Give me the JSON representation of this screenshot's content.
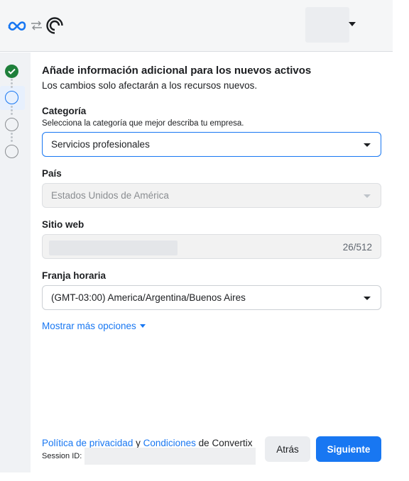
{
  "header": {
    "icons": [
      "meta-logo-icon",
      "swap-arrows-icon",
      "brand-logo-icon"
    ]
  },
  "stepper": {
    "steps": [
      {
        "state": "done",
        "icon": "check-icon"
      },
      {
        "state": "current"
      },
      {
        "state": "todo"
      },
      {
        "state": "todo"
      }
    ]
  },
  "form": {
    "title": "Añade información adicional para los nuevos activos",
    "subtitle": "Los cambios solo afectarán a los recursos nuevos.",
    "category": {
      "label": "Categoría",
      "help": "Selecciona la categoría que mejor describa tu empresa.",
      "value": "Servicios profesionales"
    },
    "country": {
      "label": "País",
      "value": "Estados Unidos de América"
    },
    "website": {
      "label": "Sitio web",
      "counter": "26/512"
    },
    "timezone": {
      "label": "Franja horaria",
      "value": "(GMT-03:00) America/Argentina/Buenos Aires"
    },
    "more_options": "Mostrar más opciones"
  },
  "footer": {
    "privacy_link": "Política de privacidad",
    "and": "y",
    "terms_link": "Condiciones",
    "of_company": "de Convertix",
    "session_label": "Session ID:",
    "back_label": "Atrás",
    "next_label": "Siguiente"
  },
  "colors": {
    "accent": "#1877f2",
    "success": "#1e7f3b"
  }
}
